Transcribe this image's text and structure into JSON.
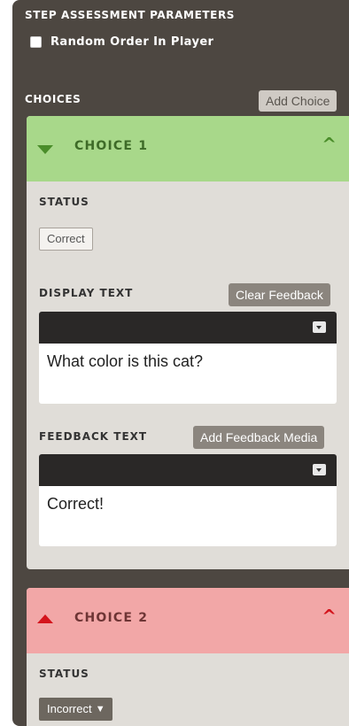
{
  "step_assessment": {
    "title": "STEP ASSESSMENT PARAMETERS",
    "random_order_label": "Random Order In Player",
    "random_order_checked": false
  },
  "choices": {
    "title": "CHOICES",
    "add_choice_label": "Add Choice",
    "items": [
      {
        "title": "CHOICE 1",
        "status_label": "STATUS",
        "status_value": "Correct",
        "display_text_label": "DISPLAY TEXT",
        "clear_feedback_label": "Clear Feedback",
        "display_text": "What color is this cat?",
        "feedback_text_label": "FEEDBACK TEXT",
        "add_feedback_media_label": "Add Feedback Media",
        "feedback_text": "Correct!",
        "header_color": "#a8d88a"
      },
      {
        "title": "CHOICE 2",
        "status_label": "STATUS",
        "status_value": "Incorrect",
        "header_color": "#f2a7a7"
      }
    ]
  },
  "icons": {
    "expand": "triangle-down-icon",
    "collapse": "chevron-up-icon",
    "dropdown": "dropdown-icon"
  }
}
